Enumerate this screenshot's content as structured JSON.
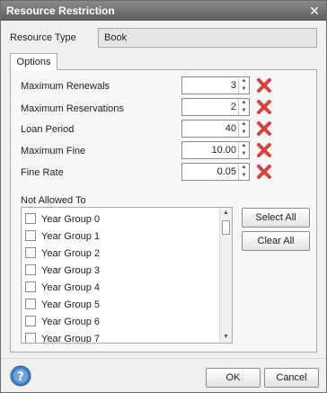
{
  "window": {
    "title": "Resource Restriction",
    "close_glyph": "✕"
  },
  "resource_type": {
    "label": "Resource Type",
    "value": "Book"
  },
  "tab": {
    "label": "Options"
  },
  "fields": [
    {
      "label": "Maximum Renewals",
      "value": "3"
    },
    {
      "label": "Maximum Reservations",
      "value": "2"
    },
    {
      "label": "Loan Period",
      "value": "40"
    },
    {
      "label": "Maximum Fine",
      "value": "10.00"
    },
    {
      "label": "Fine Rate",
      "value": "0.05"
    }
  ],
  "not_allowed": {
    "label": "Not Allowed To",
    "items": [
      "Year Group 0",
      "Year Group 1",
      "Year Group 2",
      "Year Group 3",
      "Year Group 4",
      "Year Group 5",
      "Year Group 6",
      "Year Group 7"
    ]
  },
  "buttons": {
    "select_all": "Select All",
    "clear_all": "Clear All",
    "ok": "OK",
    "cancel": "Cancel"
  },
  "icons": {
    "help": "help-icon",
    "delete": "red-x-icon"
  },
  "colors": {
    "title_bar": "#6e6e6e",
    "delete_red": "#d9423c",
    "help_blue": "#3f7fc4"
  }
}
